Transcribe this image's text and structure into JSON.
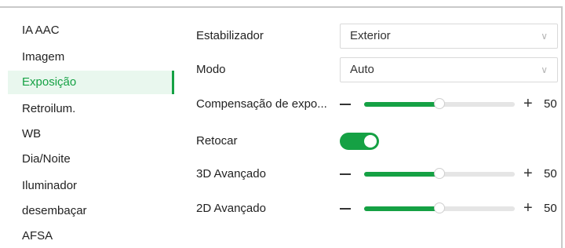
{
  "sidebar": {
    "items": [
      {
        "label": "IA AAC"
      },
      {
        "label": "Imagem"
      },
      {
        "label": "Exposição",
        "active": true
      },
      {
        "label": "Retroilum."
      },
      {
        "label": "WB"
      },
      {
        "label": "Dia/Noite"
      },
      {
        "label": "Iluminador"
      },
      {
        "label": "desembaçar"
      },
      {
        "label": "AFSA"
      }
    ]
  },
  "settings": {
    "estabilizador": {
      "label": "Estabilizador",
      "value": "Exterior"
    },
    "modo": {
      "label": "Modo",
      "value": "Auto"
    },
    "compensacao": {
      "label": "Compensação de expo...",
      "value": "50",
      "level": 0.5
    },
    "retocar": {
      "label": "Retocar",
      "enabled": true
    },
    "avancado_3d": {
      "label": "3D Avançado",
      "value": "50",
      "level": 0.5
    },
    "avancado_2d": {
      "label": "2D Avançado",
      "value": "50",
      "level": 0.5
    }
  },
  "icons": {
    "chevron": "chevron-down-icon",
    "minus": "minus-icon",
    "plus": "plus-icon"
  },
  "colors": {
    "accent": "#15a144",
    "active_bg": "#e9f7ee"
  }
}
